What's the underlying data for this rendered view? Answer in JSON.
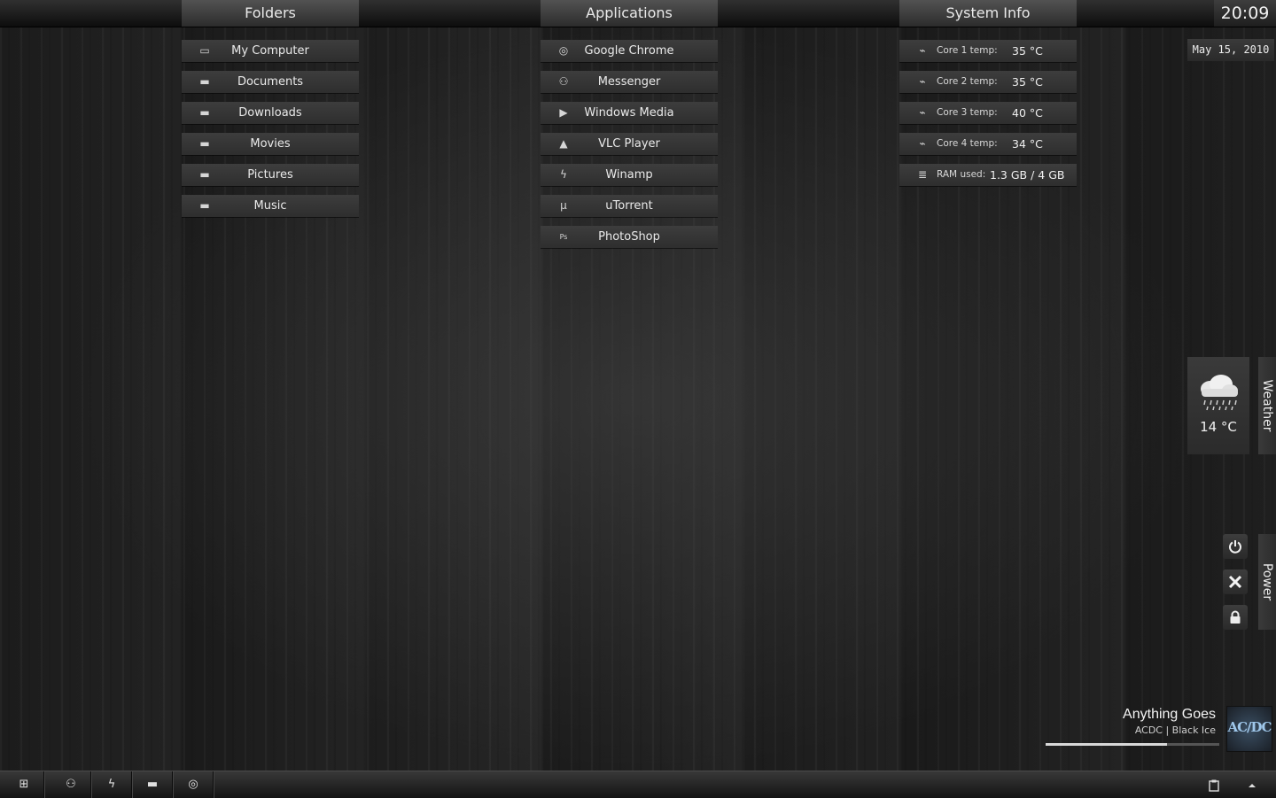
{
  "headers": {
    "folders": "Folders",
    "applications": "Applications",
    "system_info": "System Info"
  },
  "clock": {
    "time": "20:09",
    "date": "May 15, 2010"
  },
  "folders": [
    {
      "label": "My Computer",
      "icon": "computer-icon",
      "glyph": "▭"
    },
    {
      "label": "Documents",
      "icon": "folder-icon",
      "glyph": "▬"
    },
    {
      "label": "Downloads",
      "icon": "folder-icon",
      "glyph": "▬"
    },
    {
      "label": "Movies",
      "icon": "folder-icon",
      "glyph": "▬"
    },
    {
      "label": "Pictures",
      "icon": "folder-icon",
      "glyph": "▬"
    },
    {
      "label": "Music",
      "icon": "folder-icon",
      "glyph": "▬"
    }
  ],
  "applications": [
    {
      "label": "Google Chrome",
      "icon": "chrome-icon",
      "glyph": "◎"
    },
    {
      "label": "Messenger",
      "icon": "messenger-icon",
      "glyph": "⚇"
    },
    {
      "label": "Windows Media",
      "icon": "play-icon",
      "glyph": "▶"
    },
    {
      "label": "VLC Player",
      "icon": "vlc-cone-icon",
      "glyph": "▲"
    },
    {
      "label": "Winamp",
      "icon": "winamp-bolt-icon",
      "glyph": "ϟ"
    },
    {
      "label": "uTorrent",
      "icon": "utorrent-icon",
      "glyph": "µ"
    },
    {
      "label": "PhotoShop",
      "icon": "photoshop-icon",
      "glyph": "Ps"
    }
  ],
  "system_info": {
    "cores": [
      {
        "label": "Core 1 temp:",
        "value": "35 °C"
      },
      {
        "label": "Core 2 temp:",
        "value": "35 °C"
      },
      {
        "label": "Core 3 temp:",
        "value": "40 °C"
      },
      {
        "label": "Core 4 temp:",
        "value": "34 °C"
      }
    ],
    "ram": {
      "label": "RAM used:",
      "value": "1.3 GB / 4 GB"
    },
    "pulse_glyph": "⌁",
    "ram_glyph": "≣"
  },
  "weather": {
    "temperature": "14 °C",
    "tab_label": "Weather",
    "condition_icon": "rain-cloud-icon"
  },
  "power": {
    "tab_label": "Power",
    "buttons": [
      "power-icon",
      "close-icon",
      "lock-icon"
    ]
  },
  "now_playing": {
    "title": "Anything Goes",
    "subtitle": "ACDC | Black Ice",
    "album_art_text": "AC/DC",
    "progress": 0.7
  },
  "taskbar": {
    "buttons": [
      {
        "icon": "start-icon",
        "glyph": "⊞"
      },
      {
        "icon": "messenger-icon",
        "glyph": "⚇"
      },
      {
        "icon": "winamp-bolt-icon",
        "glyph": "ϟ"
      },
      {
        "icon": "folder-icon",
        "glyph": "▬"
      },
      {
        "icon": "chrome-icon",
        "glyph": "◎"
      }
    ]
  }
}
